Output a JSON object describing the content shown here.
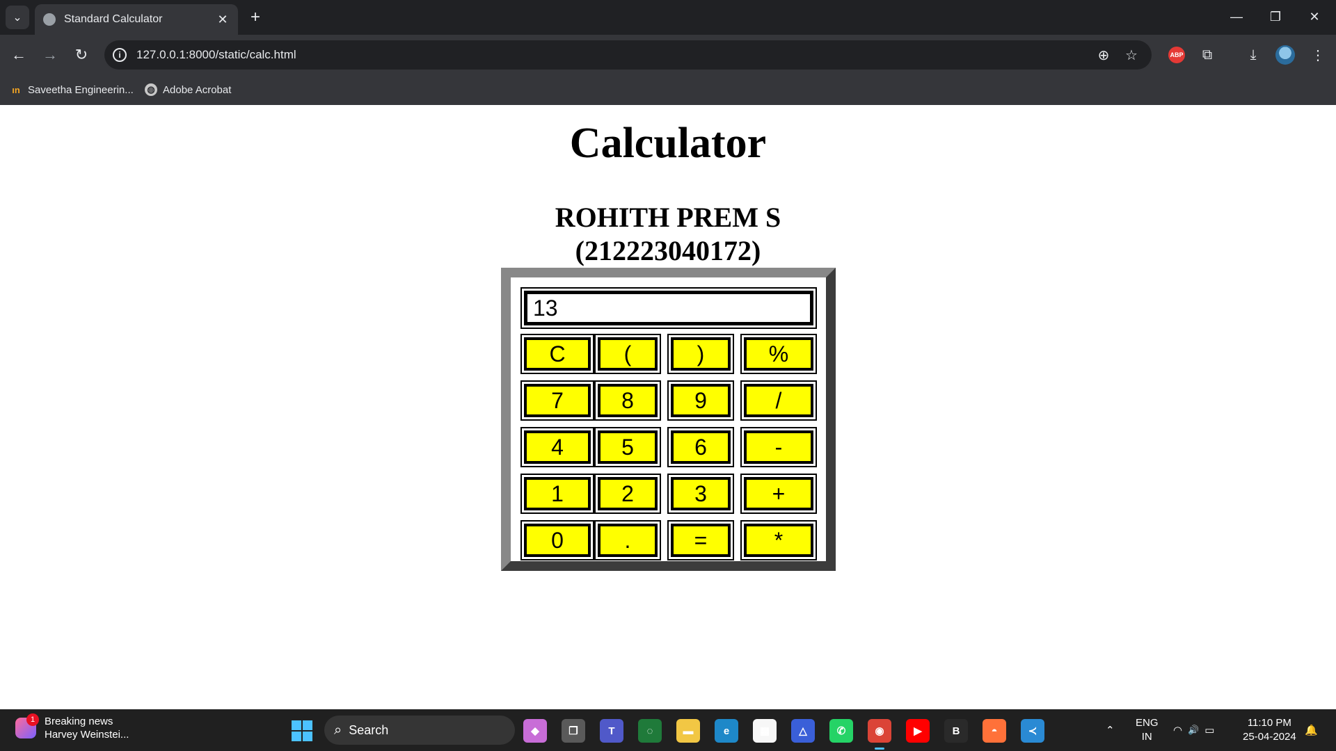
{
  "browser": {
    "tab_title": "Standard Calculator",
    "tab_close": "✕",
    "new_tab": "+",
    "tab_menu": "⌄",
    "url": "127.0.0.1:8000/static/calc.html",
    "abp_label": "ABP",
    "window_controls": {
      "minimize": "—",
      "restore": "❐",
      "close": "✕"
    },
    "nav": {
      "back": "←",
      "forward": "→",
      "reload": "↻",
      "info": "i"
    },
    "omni_icons": {
      "zoom": "⊕",
      "star": "☆"
    },
    "toolbar_icons": {
      "extensions": "⧉",
      "download": "⤓",
      "menu": "⋮"
    },
    "bookmarks": [
      {
        "label": "Saveetha Engineerin...",
        "icon": "saveetha-logo-icon",
        "glyph": "ın"
      },
      {
        "label": "Adobe Acrobat",
        "icon": "globe-icon",
        "glyph": "◍"
      }
    ]
  },
  "page": {
    "title": "Calculator",
    "student_name": "ROHITH PREM S",
    "student_id": "(212223040172)"
  },
  "calculator": {
    "display_value": "13",
    "keys": [
      [
        "C",
        "(",
        ")",
        "%"
      ],
      [
        "7",
        "8",
        "9",
        "/"
      ],
      [
        "4",
        "5",
        "6",
        "-"
      ],
      [
        "1",
        "2",
        "3",
        "+"
      ],
      [
        "0",
        ".",
        "=",
        "*"
      ]
    ],
    "colors": {
      "key_bg": "#ffff00",
      "frame_light": "#888888",
      "frame_dark": "#3c3c3c"
    }
  },
  "taskbar": {
    "news_badge": "1",
    "news_title": "Breaking news",
    "news_subtitle": "Harvey Weinstei...",
    "search_label": "Search",
    "search_glyph": "⌕",
    "lang_top": "ENG",
    "lang_bottom": "IN",
    "time": "11:10 PM",
    "date": "25-04-2024",
    "tray_chevron": "⌃",
    "tray_icons": {
      "wifi": "◠",
      "volume": "🔊",
      "battery": "▭",
      "bell": "🔔"
    },
    "apps": [
      {
        "name": "copilot-icon",
        "glyph": "◆",
        "color": "#c86dd7"
      },
      {
        "name": "task-view-icon",
        "glyph": "❐",
        "color": "#5a5a5a"
      },
      {
        "name": "teams-icon",
        "glyph": "T",
        "color": "#5059c9"
      },
      {
        "name": "cycle-app-icon",
        "glyph": "◌",
        "color": "#1f7a3a"
      },
      {
        "name": "file-explorer-icon",
        "glyph": "▬",
        "color": "#f2c744"
      },
      {
        "name": "edge-icon",
        "glyph": "e",
        "color": "#1e88c8"
      },
      {
        "name": "store-icon",
        "glyph": "▦",
        "color": "#f7f7f7"
      },
      {
        "name": "arc-app-icon",
        "glyph": "△",
        "color": "#3a5fd8"
      },
      {
        "name": "whatsapp-icon",
        "glyph": "✆",
        "color": "#25d366"
      },
      {
        "name": "chrome-icon",
        "glyph": "◉",
        "color": "#db4437"
      },
      {
        "name": "youtube-icon",
        "glyph": "▶",
        "color": "#ff0000"
      },
      {
        "name": "app-b-icon",
        "glyph": "B",
        "color": "#2a2a2a"
      },
      {
        "name": "firefox-icon",
        "glyph": "◓",
        "color": "#ff7139"
      },
      {
        "name": "vscode-icon",
        "glyph": "≺",
        "color": "#2a8ad4"
      }
    ]
  }
}
